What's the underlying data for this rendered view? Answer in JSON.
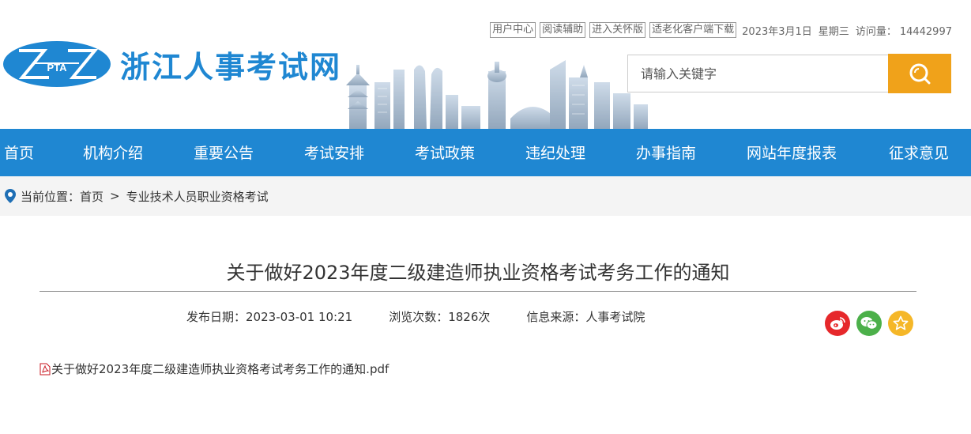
{
  "header": {
    "top_links": [
      "用户中心",
      "阅读辅助",
      "进入关怀版",
      "适老化客户端下载"
    ],
    "date": "2023年3月1日",
    "weekday": "星期三",
    "visits_label": "访问量：",
    "visits_count": "14442997",
    "logo_text": "PTA",
    "site_title": "浙江人事考试网"
  },
  "search": {
    "placeholder": "请输入关键字",
    "icon": "search-icon"
  },
  "nav": {
    "items": [
      "首页",
      "机构介绍",
      "重要公告",
      "考试安排",
      "考试政策",
      "违纪处理",
      "办事指南",
      "网站年度报表",
      "征求意见"
    ]
  },
  "breadcrumb": {
    "label": "当前位置：",
    "home": "首页",
    "separator": ">",
    "current": "专业技术人员职业资格考试"
  },
  "article": {
    "title": "关于做好2023年度二级建造师执业资格考试考务工作的通知",
    "publish_label": "发布日期：",
    "publish_value": "2023-03-01 10:21",
    "views_label": "浏览次数：",
    "views_value": "1826次",
    "source_label": "信息来源：",
    "source_value": "人事考试院",
    "attachment": "关于做好2023年度二级建造师执业资格考试考务工作的通知.pdf"
  },
  "share": {
    "icons": [
      "weibo-icon",
      "wechat-icon",
      "favorite-icon"
    ],
    "colors": [
      "#e6282b",
      "#4cb04a",
      "#f5b728"
    ]
  },
  "colors": {
    "brand_blue": "#1f87d2",
    "search_orange": "#f0a21a",
    "breadcrumb_bg": "#f4f4f4"
  }
}
